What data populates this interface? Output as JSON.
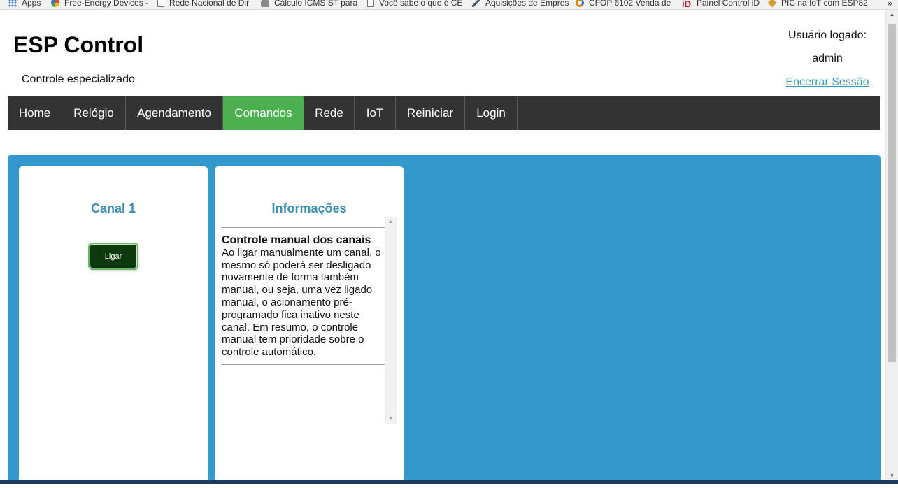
{
  "bookmarks": [
    {
      "label": "Apps",
      "icon": "apps-icon"
    },
    {
      "label": "Free-Energy Devices -",
      "icon": "globe-icon"
    },
    {
      "label": "Rede Nacional de Dir",
      "icon": "page-icon"
    },
    {
      "label": "Cálculo ICMS ST para",
      "icon": "person-icon"
    },
    {
      "label": "Você sabe o que é CE",
      "icon": "page-icon"
    },
    {
      "label": "Aquisições de Empres",
      "icon": "chevron-icon"
    },
    {
      "label": "CFOP 6102 Venda de",
      "icon": "ring-icon"
    },
    {
      "label": "Painel Control iD",
      "icon": "id-icon"
    },
    {
      "label": "PIC na IoT com ESP82",
      "icon": "diamond-icon"
    }
  ],
  "bookmarks_more": "»",
  "header": {
    "brand": "ESP Control",
    "tagline": "Controle especializado",
    "user_label": "Usuário logado:",
    "user_name": "admin",
    "logout": "Encerrar Sessão"
  },
  "nav": {
    "items": [
      {
        "label": "Home"
      },
      {
        "label": "Relógio"
      },
      {
        "label": "Agendamento"
      },
      {
        "label": "Comandos",
        "active": true
      },
      {
        "label": "Rede"
      },
      {
        "label": "IoT"
      },
      {
        "label": "Reiniciar"
      },
      {
        "label": "Login"
      }
    ],
    "active_color": "#4caf50",
    "bar_color": "#333333"
  },
  "content": {
    "background_color": "#3399cc",
    "channel_card": {
      "title": "Canal 1",
      "button_label": "Ligar"
    },
    "info_card": {
      "title": "Informações",
      "heading": "Controle manual dos canais",
      "body": "Ao ligar manualmente um canal, o mesmo só poderá ser desligado novamente de forma também manual, ou seja, uma vez ligado manual, o acionamento pré-programado fica inativo neste canal. Em resumo, o controle manual tem prioridade sobre o controle automático."
    }
  },
  "scroll_glyphs": {
    "up": "▲",
    "down": "▼"
  }
}
